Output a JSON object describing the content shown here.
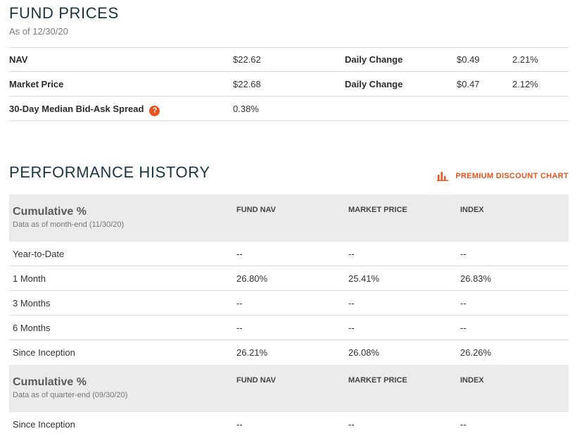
{
  "fund_prices": {
    "title": "FUND PRICES",
    "as_of": "As of 12/30/20",
    "rows": [
      {
        "label": "NAV",
        "value": "$22.62",
        "change_label": "Daily Change",
        "change_amount": "$0.49",
        "change_pct": "2.21%"
      },
      {
        "label": "Market Price",
        "value": "$22.68",
        "change_label": "Daily Change",
        "change_amount": "$0.47",
        "change_pct": "2.12%"
      },
      {
        "label": "30-Day Median Bid-Ask Spread",
        "value": "0.38%",
        "help_icon": "?"
      }
    ]
  },
  "performance": {
    "title": "PERFORMANCE HISTORY",
    "chart_link": {
      "label": "PREMIUM DISCOUNT CHART",
      "icon": "bar-chart-icon",
      "color": "#e8541d"
    },
    "tables": [
      {
        "title": "Cumulative %",
        "subtitle": "Data as of month-end (11/30/20)",
        "columns": [
          "FUND NAV",
          "MARKET PRICE",
          "INDEX"
        ],
        "rows": [
          {
            "label": "Year-to-Date",
            "values": [
              "--",
              "--",
              "--"
            ]
          },
          {
            "label": "1 Month",
            "values": [
              "26.80%",
              "25.41%",
              "26.83%"
            ]
          },
          {
            "label": "3 Months",
            "values": [
              "--",
              "--",
              "--"
            ]
          },
          {
            "label": "6 Months",
            "values": [
              "--",
              "--",
              "--"
            ]
          },
          {
            "label": "Since Inception",
            "values": [
              "26.21%",
              "26.08%",
              "26.26%"
            ]
          }
        ]
      },
      {
        "title": "Cumulative %",
        "subtitle": "Data as of quarter-end (09/30/20)",
        "columns": [
          "FUND NAV",
          "MARKET PRICE",
          "INDEX"
        ],
        "rows": [
          {
            "label": "Since Inception",
            "values": [
              "--",
              "--",
              "--"
            ]
          }
        ]
      }
    ]
  },
  "colors": {
    "accent": "#e8541d",
    "title": "#1b3443",
    "header_bg": "#ebebeb"
  }
}
